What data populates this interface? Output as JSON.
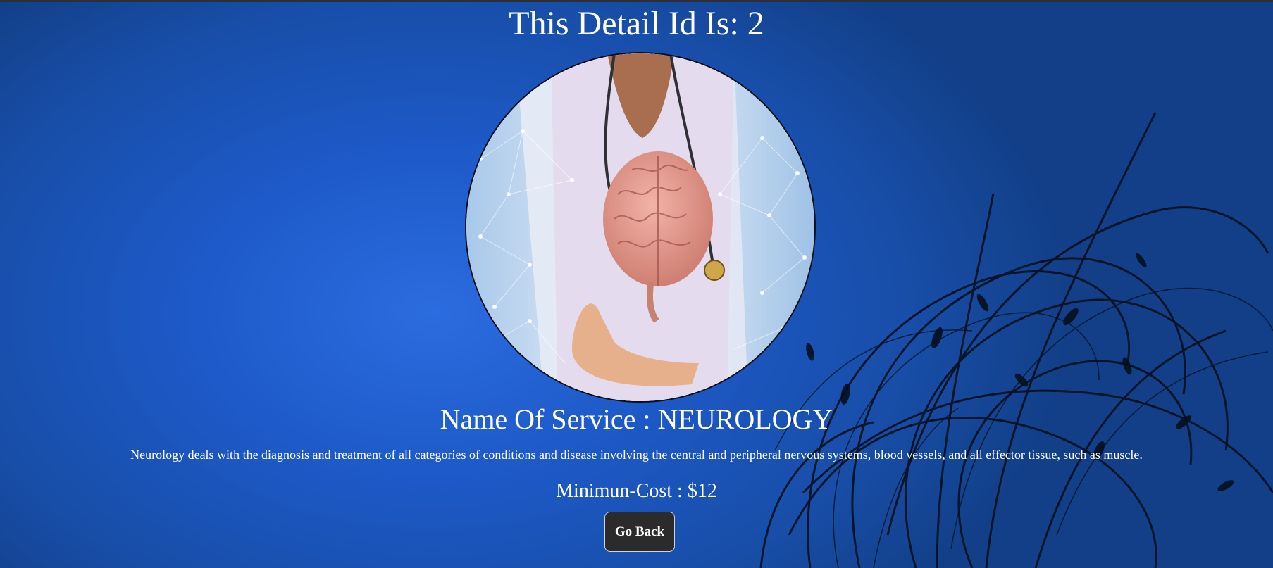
{
  "page": {
    "heading": "This Detail Id Is: 2"
  },
  "service": {
    "image": "neurology-doctor-brain-image",
    "name_line": "Name Of Service : NEUROLOGY",
    "description": "Neurology deals with the diagnosis and treatment of all categories of conditions and disease involving the central and peripheral nervous systems, blood vessels, and all effector tissue, such as muscle.",
    "cost_line": "Minimun-Cost : $12"
  },
  "actions": {
    "go_back_label": "Go Back"
  },
  "colors": {
    "background": "#1d59c7",
    "button": "#2c2b2b",
    "text": "#ffffff"
  }
}
